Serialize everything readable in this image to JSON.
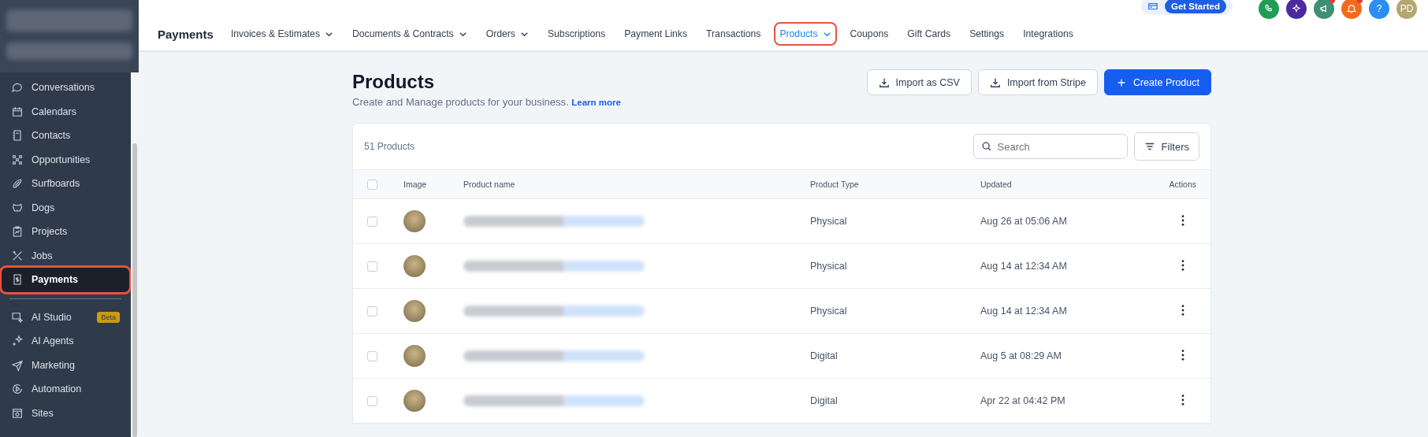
{
  "sidebar": {
    "items": [
      {
        "label": "Conversations",
        "selected": false
      },
      {
        "label": "Calendars",
        "selected": false
      },
      {
        "label": "Contacts",
        "selected": false
      },
      {
        "label": "Opportunities",
        "selected": false
      },
      {
        "label": "Surfboards",
        "selected": false
      },
      {
        "label": "Dogs",
        "selected": false
      },
      {
        "label": "Projects",
        "selected": false
      },
      {
        "label": "Jobs",
        "selected": false
      },
      {
        "label": "Payments",
        "selected": true
      }
    ],
    "items_2": [
      {
        "label": "AI Studio",
        "selected": false,
        "badge": "Beta"
      },
      {
        "label": "AI Agents",
        "selected": false
      },
      {
        "label": "Marketing",
        "selected": false
      },
      {
        "label": "Automation",
        "selected": false
      },
      {
        "label": "Sites",
        "selected": false
      }
    ]
  },
  "top_nav": {
    "title": "Payments",
    "tabs": [
      {
        "label": "Invoices & Estimates",
        "dropdown": true,
        "selected": false
      },
      {
        "label": "Documents & Contracts",
        "dropdown": true,
        "selected": false
      },
      {
        "label": "Orders",
        "dropdown": true,
        "selected": false
      },
      {
        "label": "Subscriptions",
        "dropdown": false,
        "selected": false
      },
      {
        "label": "Payment Links",
        "dropdown": false,
        "selected": false
      },
      {
        "label": "Transactions",
        "dropdown": false,
        "selected": false
      },
      {
        "label": "Products",
        "dropdown": true,
        "selected": true
      },
      {
        "label": "Coupons",
        "dropdown": false,
        "selected": false
      },
      {
        "label": "Gift Cards",
        "dropdown": false,
        "selected": false
      },
      {
        "label": "Settings",
        "dropdown": false,
        "selected": false
      },
      {
        "label": "Integrations",
        "dropdown": false,
        "selected": false
      }
    ],
    "get_started": "Get Started",
    "header_icons": [
      {
        "kind": "phone",
        "color": "#1f9d55",
        "notification": false
      },
      {
        "kind": "sparkle",
        "color": "#4c2a9e",
        "notification": false
      },
      {
        "kind": "megaphone",
        "color": "#3f8f74",
        "notification": true
      },
      {
        "kind": "bell",
        "color": "#f26b1d",
        "notification": true
      },
      {
        "kind": "text",
        "text": "?",
        "color": "#2b8ef0",
        "notification": false
      },
      {
        "kind": "text",
        "text": "PD",
        "color": "#b5a66e",
        "notification": false
      }
    ]
  },
  "page": {
    "title": "Products",
    "subtitle": "Create and Manage products for your business.",
    "learn_more": "Learn more",
    "buttons": [
      {
        "label": "Import as CSV",
        "kind": "download"
      },
      {
        "label": "Import from Stripe",
        "kind": "download"
      },
      {
        "label": "Create Product",
        "kind": "primary"
      }
    ]
  },
  "table": {
    "count": "51 Products",
    "search": {
      "placeholder": "Search"
    },
    "filters": "Filters",
    "header_checked": false,
    "columns": [
      "Image",
      "Product name",
      "Product Type",
      "Updated",
      "Actions"
    ],
    "rows": [
      {
        "checked": false,
        "type": "Physical",
        "updated": "Aug 26 at 05:06 AM"
      },
      {
        "checked": false,
        "type": "Physical",
        "updated": "Aug 14 at 12:34 AM"
      },
      {
        "checked": false,
        "type": "Physical",
        "updated": "Aug 14 at 12:34 AM"
      },
      {
        "checked": false,
        "type": "Digital",
        "updated": "Aug 5 at 08:29 AM"
      },
      {
        "checked": false,
        "type": "Digital",
        "updated": "Apr 22 at 04:42 PM"
      }
    ]
  }
}
